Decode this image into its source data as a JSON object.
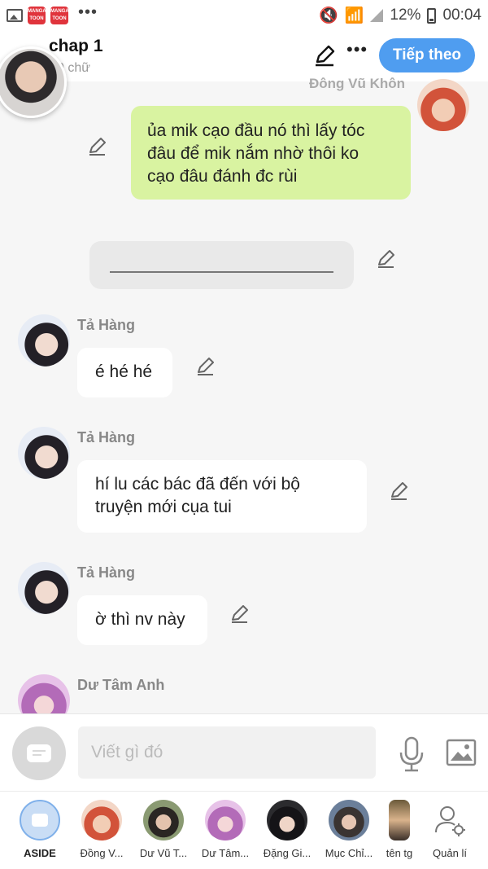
{
  "status_bar": {
    "battery_text": "12%",
    "time": "00:04",
    "app_badge": "MANGA TOON"
  },
  "header": {
    "title": "chap 1",
    "subtitle": "0 chữ",
    "next_label": "Tiếp theo"
  },
  "messages": {
    "right_sender": "Đông Vũ Khôn",
    "green_text_1": "ủa mik cạo đầu nó thì lấy tóc",
    "green_text_2": "đâu để mik nắm nhờ thôi ko",
    "green_text_3": "cạo đâu đánh đc rùi",
    "sender_1": "Tả Hàng",
    "text_1": "é hé hé",
    "sender_2": "Tả Hàng",
    "text_2_line1": "hí lu các bác đã đến với bộ",
    "text_2_line2": "truyện mới cụa tui",
    "sender_3": "Tả Hàng",
    "text_3": "ờ thì nv này",
    "sender_4": "Dư Tâm Anh"
  },
  "composer": {
    "placeholder": "Viết gì đó"
  },
  "bottom_nav": {
    "items": [
      {
        "label": "ASIDE"
      },
      {
        "label": "Đồng V..."
      },
      {
        "label": "Dư Vũ T..."
      },
      {
        "label": "Dư Tâm..."
      },
      {
        "label": "Đặng Gi..."
      },
      {
        "label": "Mục Chỉ..."
      },
      {
        "label": "tên tg"
      },
      {
        "label": "Quản lí"
      }
    ]
  },
  "colors": {
    "accent": "#4f9df0",
    "my_bubble": "#d9f3a1",
    "their_bubble": "#ffffff",
    "background": "#f6f6f6"
  }
}
